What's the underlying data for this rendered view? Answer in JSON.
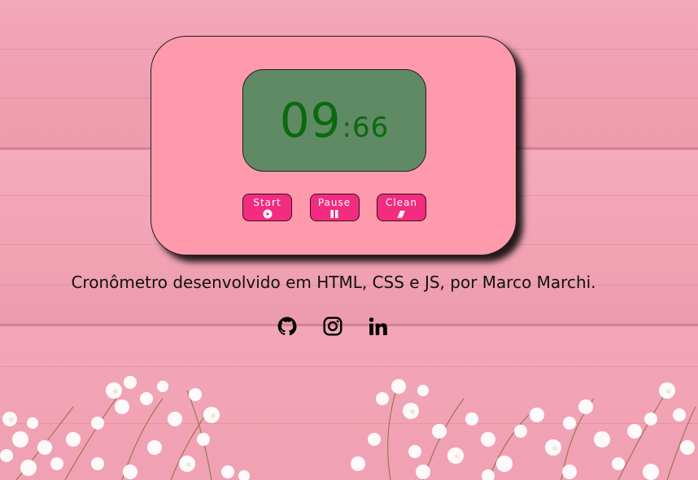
{
  "stopwatch": {
    "seconds": "09",
    "separator": ":",
    "centiseconds": "66"
  },
  "buttons": {
    "start_label": "Start",
    "pause_label": "Pause",
    "clean_label": "Clean",
    "start_icon": "play-circle-icon",
    "pause_icon": "pause-icon",
    "clean_icon": "eraser-icon"
  },
  "footer": {
    "credit": "Cronômetro desenvolvido em HTML, CSS e JS, por Marco Marchi.",
    "social": [
      "github-icon",
      "instagram-icon",
      "linkedin-icon"
    ]
  },
  "colors": {
    "card": "#fe9aab",
    "display": "#5f8a64",
    "digits": "#0a6a0d",
    "button": "#f22c7e",
    "background": "#f2a2b4"
  }
}
